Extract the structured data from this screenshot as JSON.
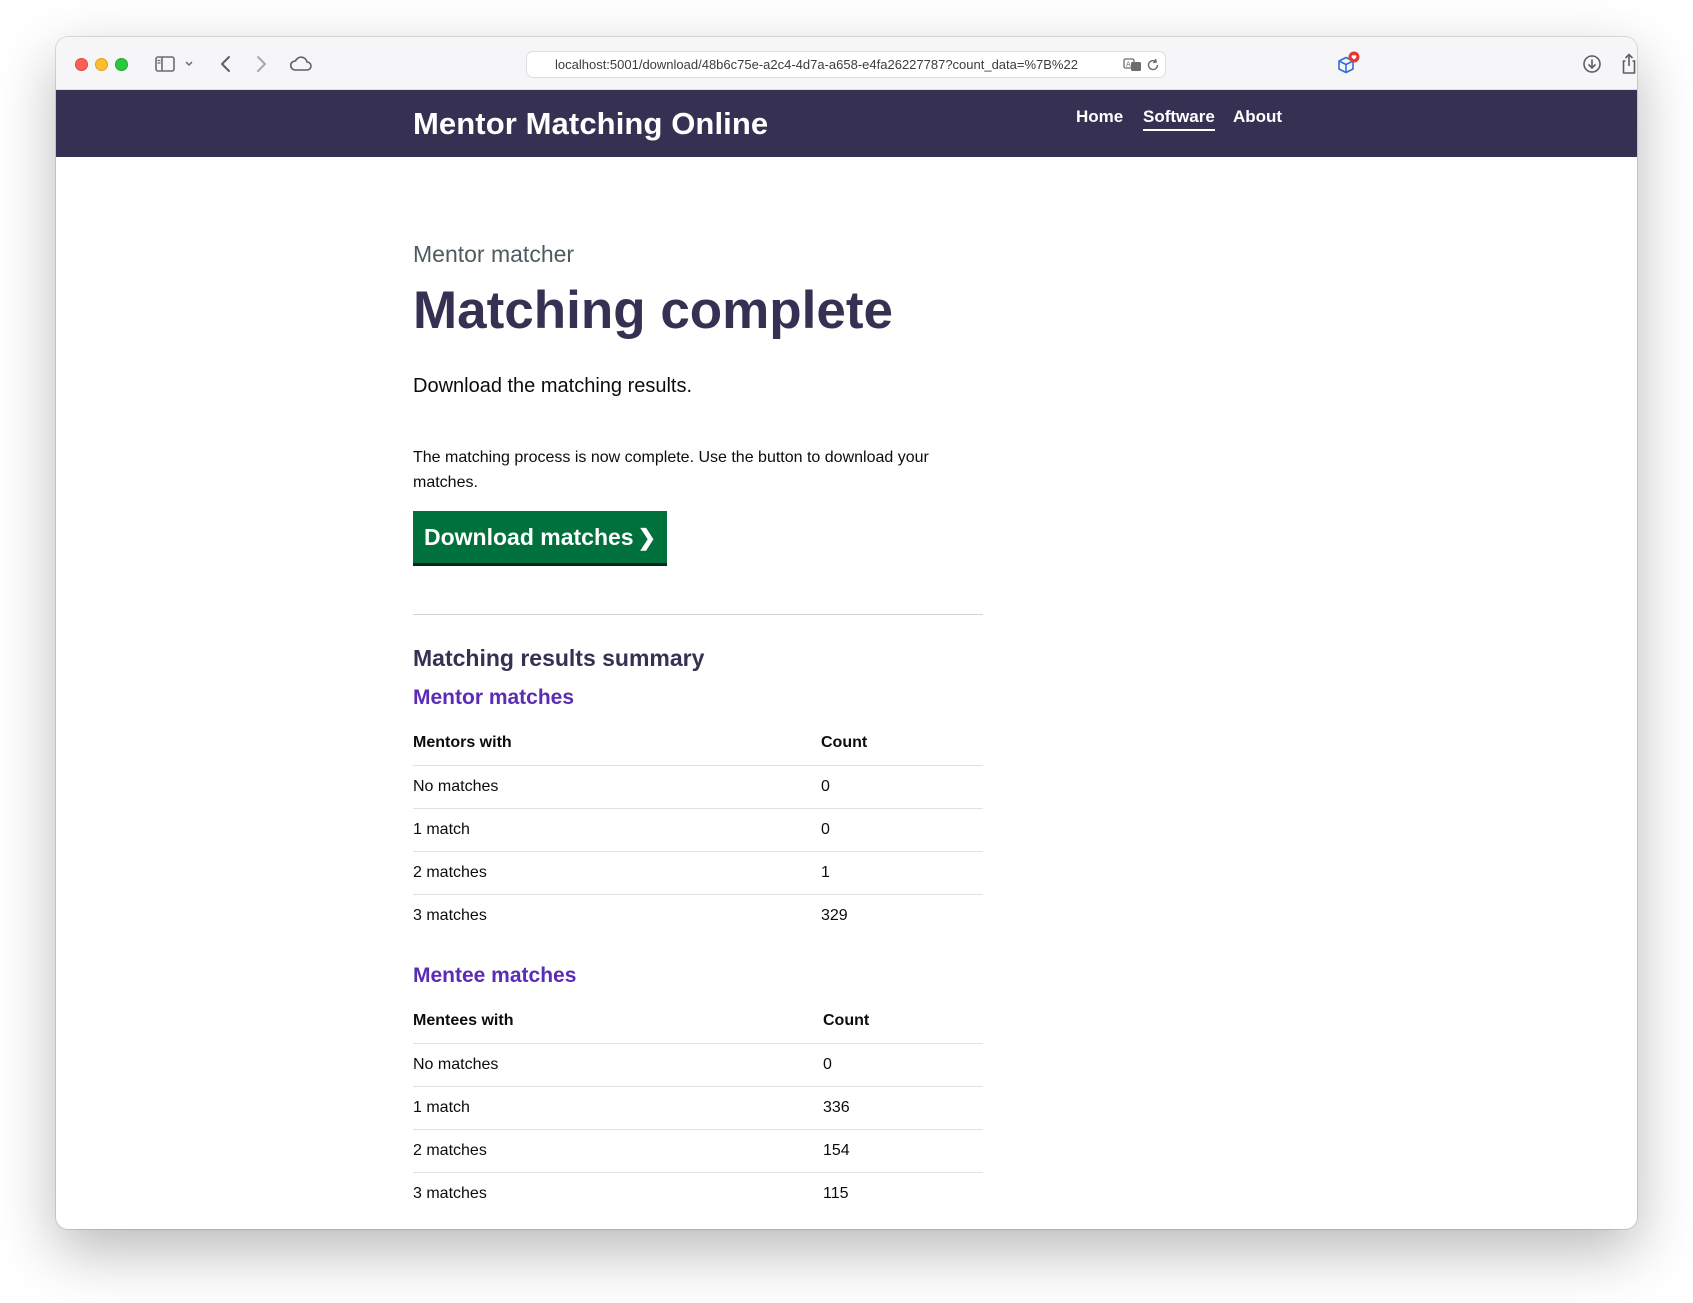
{
  "browser": {
    "url": "localhost:5001/download/48b6c75e-a2c4-4d7a-a658-e4fa26227787?count_data=%7B%22",
    "icons": [
      "sidebar-icon",
      "chevron-down-icon",
      "back-icon",
      "forward-icon",
      "cloud-icon",
      "translate-icon",
      "reload-icon",
      "extension-icon",
      "downloads-icon",
      "share-icon",
      "new-tab-icon"
    ],
    "colors": {
      "toolbar_bg": "#f6f5f7"
    }
  },
  "header": {
    "title": "Mentor Matching Online",
    "nav": [
      {
        "label": "Home",
        "active": false
      },
      {
        "label": "Software",
        "active": true
      },
      {
        "label": "About",
        "active": false
      }
    ],
    "colors": {
      "background": "#363153",
      "text": "#ffffff"
    }
  },
  "main": {
    "caption": "Mentor matcher",
    "heading": "Matching complete",
    "lead": "Download the matching results.",
    "body": "The matching process is now complete. Use the button to download your matches.",
    "download_button": {
      "label": "Download matches",
      "chevron": "❯"
    },
    "colors": {
      "heading": "#363153",
      "button": "#00703c",
      "subheading": "#5b2cb5"
    }
  },
  "summary": {
    "title": "Matching results summary",
    "mentor": {
      "title": "Mentor matches",
      "headers": [
        "Mentors with",
        "Count"
      ],
      "rows": [
        [
          "No matches",
          "0"
        ],
        [
          "1 match",
          "0"
        ],
        [
          "2 matches",
          "1"
        ],
        [
          "3 matches",
          "329"
        ]
      ]
    },
    "mentee": {
      "title": "Mentee matches",
      "headers": [
        "Mentees with",
        "Count"
      ],
      "rows": [
        [
          "No matches",
          "0"
        ],
        [
          "1 match",
          "336"
        ],
        [
          "2 matches",
          "154"
        ],
        [
          "3 matches",
          "115"
        ]
      ]
    }
  }
}
